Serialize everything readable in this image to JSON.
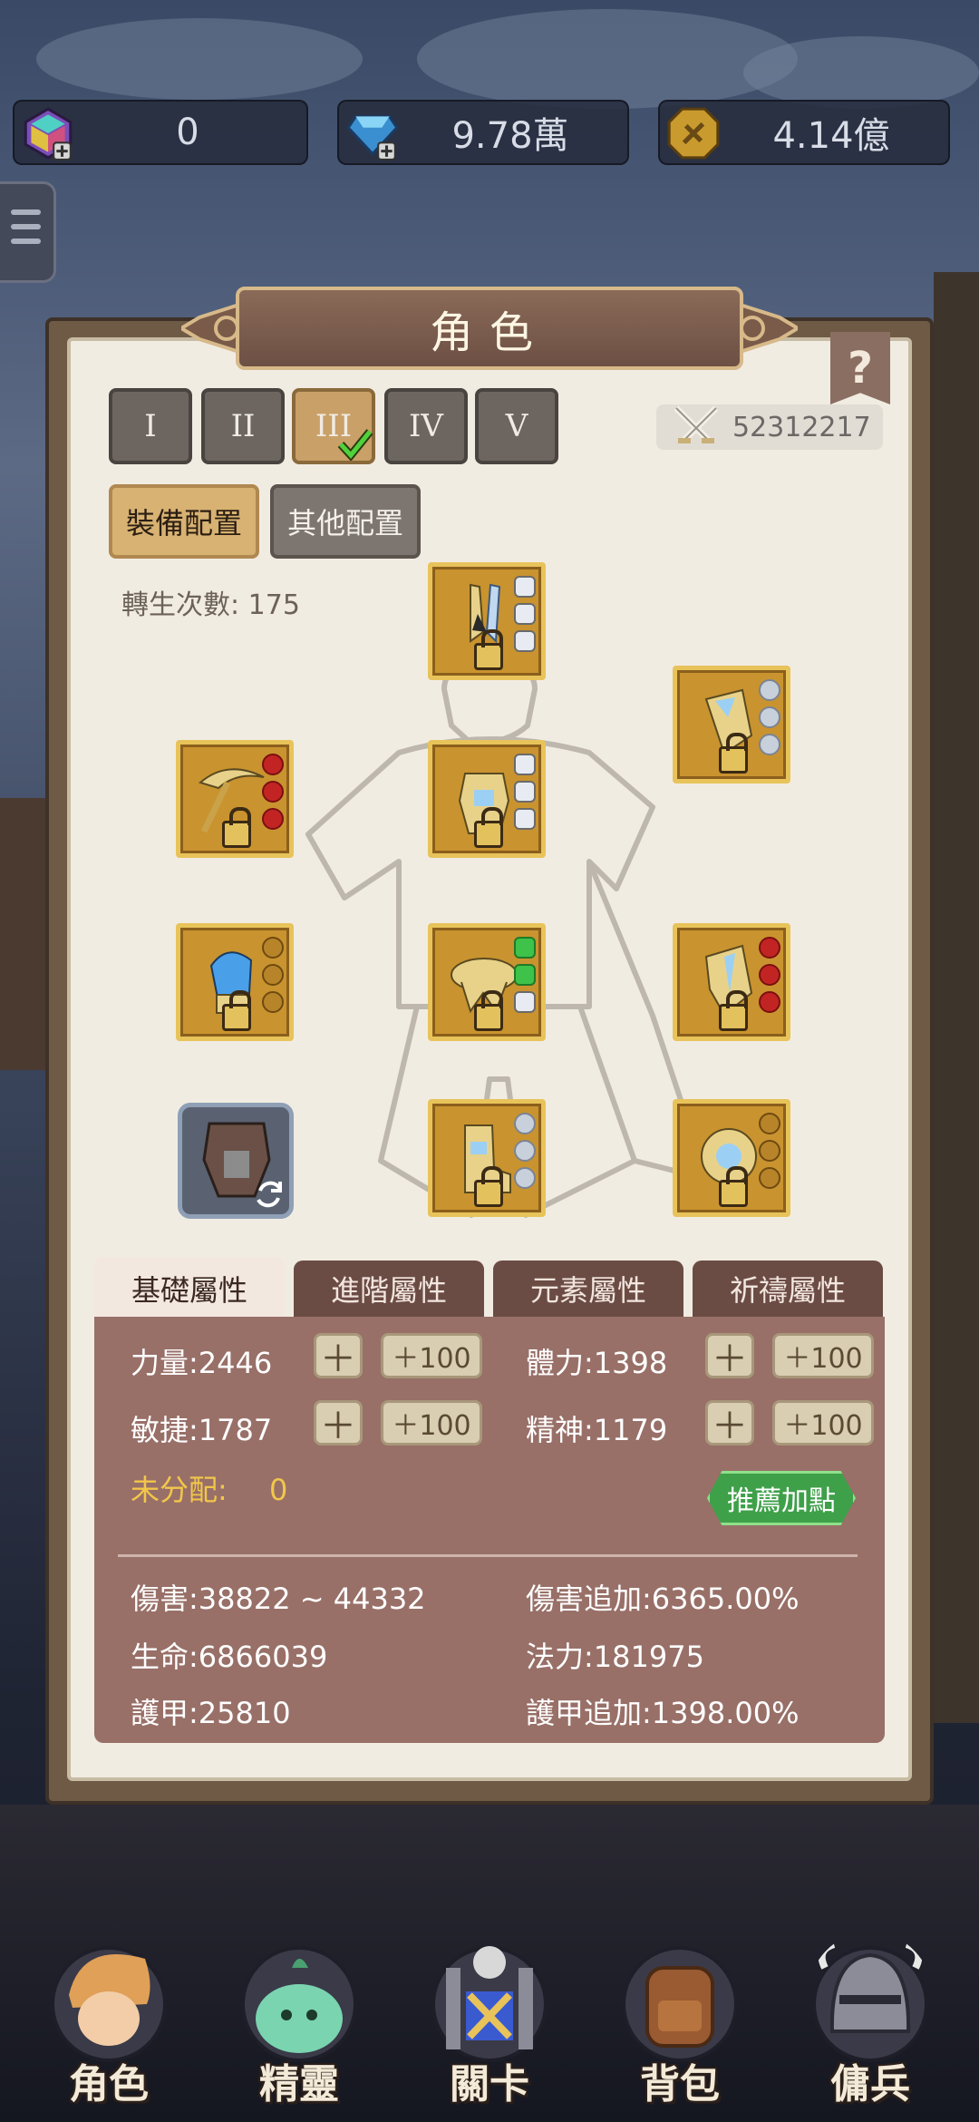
{
  "currencies": [
    {
      "icon": "rainbow-gem-icon",
      "value": "0"
    },
    {
      "icon": "diamond-icon",
      "value": "9.78萬"
    },
    {
      "icon": "gold-coin-icon",
      "value": "4.14億"
    }
  ],
  "panel": {
    "title": "角色",
    "help": "?",
    "tiers": [
      "I",
      "II",
      "III",
      "IV",
      "V"
    ],
    "active_tier_index": 2,
    "power": "52312217",
    "configs": {
      "equipment": "裝備配置",
      "other": "其他配置"
    },
    "rebirth": "轉生次數: 175"
  },
  "stats": {
    "tabs": [
      "基礎屬性",
      "進階屬性",
      "元素屬性",
      "祈禱屬性"
    ],
    "attrs": {
      "strength": "力量:2446",
      "stamina": "體力:1398",
      "agility": "敏捷:1787",
      "spirit": "精神:1179"
    },
    "plus": "＋",
    "plus100": "＋100",
    "unallocated_label": "未分配:",
    "unallocated_value": "0",
    "recommend": "推薦加點",
    "damage": "傷害:38822 ~ 44332",
    "damage_bonus": "傷害追加:6365.00%",
    "life": "生命:6866039",
    "mana": "法力:181975",
    "armor": "護甲:25810",
    "armor_bonus": "護甲追加:1398.00%"
  },
  "nav": [
    "角色",
    "精靈",
    "關卡",
    "背包",
    "傭兵"
  ],
  "colors": {
    "gold": "#c9932f",
    "panel_bg": "#f1ece2",
    "stat_bg": "#987068",
    "active_tab": "#c9a067",
    "recommend": "#3fa04a"
  }
}
